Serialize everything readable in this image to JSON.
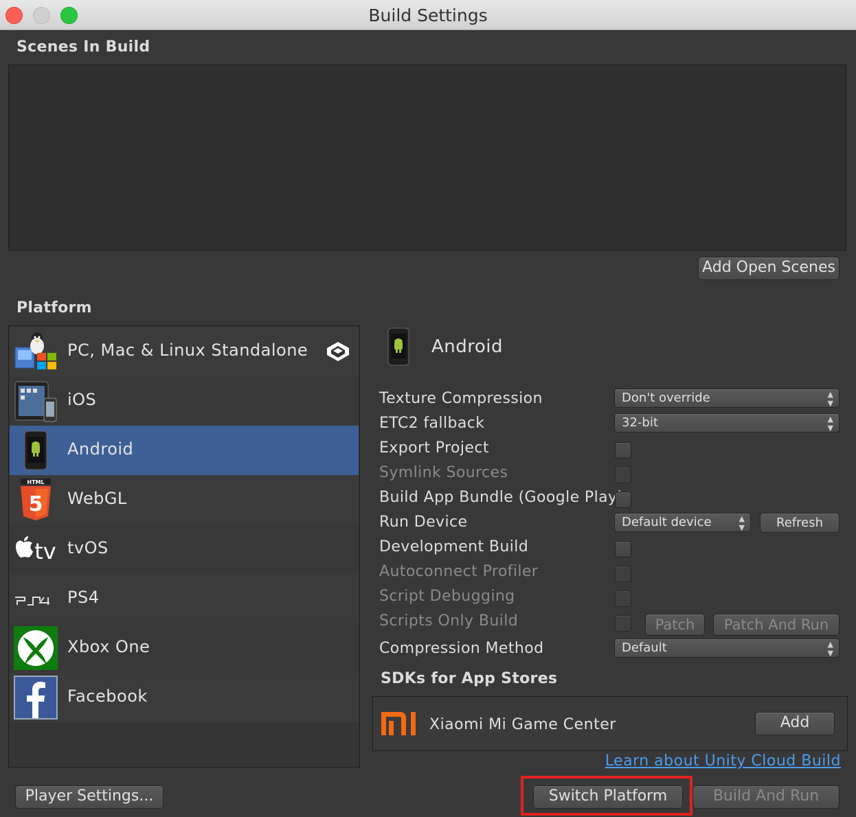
{
  "window": {
    "title": "Build Settings"
  },
  "scenes": {
    "label": "Scenes In Build",
    "add_open_scenes": "Add Open Scenes"
  },
  "platform": {
    "label": "Platform",
    "items": [
      {
        "label": "PC, Mac & Linux Standalone",
        "icon": "standalone-icon",
        "active_target": true
      },
      {
        "label": "iOS",
        "icon": "ios-icon"
      },
      {
        "label": "Android",
        "icon": "android-icon",
        "selected": true
      },
      {
        "label": "WebGL",
        "icon": "html5-icon"
      },
      {
        "label": "tvOS",
        "icon": "apple-tv-icon"
      },
      {
        "label": "PS4",
        "icon": "ps4-icon"
      },
      {
        "label": "Xbox One",
        "icon": "xbox-icon"
      },
      {
        "label": "Facebook",
        "icon": "facebook-icon"
      }
    ]
  },
  "selected_platform": {
    "title": "Android",
    "icon": "android-phone-icon"
  },
  "settings": {
    "texture_compression": {
      "label": "Texture Compression",
      "value": "Don't override"
    },
    "etc2_fallback": {
      "label": "ETC2 fallback",
      "value": "32-bit"
    },
    "export_project": {
      "label": "Export Project",
      "checked": false
    },
    "symlink_sources": {
      "label": "Symlink Sources",
      "checked": false,
      "enabled": false
    },
    "build_app_bundle": {
      "label": "Build App Bundle (Google Play)",
      "checked": false
    },
    "run_device": {
      "label": "Run Device",
      "value": "Default device",
      "refresh": "Refresh"
    },
    "development_build": {
      "label": "Development Build",
      "checked": false
    },
    "autoconnect_profiler": {
      "label": "Autoconnect Profiler",
      "checked": false,
      "enabled": false
    },
    "script_debugging": {
      "label": "Script Debugging",
      "checked": false,
      "enabled": false
    },
    "scripts_only_build": {
      "label": "Scripts Only Build",
      "checked": false,
      "enabled": false,
      "patch": "Patch",
      "patch_and_run": "Patch And Run"
    },
    "compression_method": {
      "label": "Compression Method",
      "value": "Default"
    }
  },
  "sdks": {
    "label": "SDKs for App Stores",
    "items": [
      {
        "label": "Xiaomi Mi Game Center",
        "icon": "xiaomi-mi-icon",
        "action": "Add"
      }
    ]
  },
  "links": {
    "cloud_build": "Learn about Unity Cloud Build"
  },
  "footer": {
    "player_settings": "Player Settings...",
    "switch_platform": "Switch Platform",
    "build_and_run": "Build And Run"
  },
  "colors": {
    "selection": "#3e5f96",
    "link": "#4c9cf0",
    "highlight_box": "#e0231f",
    "xiaomi_orange": "#f26a12"
  }
}
